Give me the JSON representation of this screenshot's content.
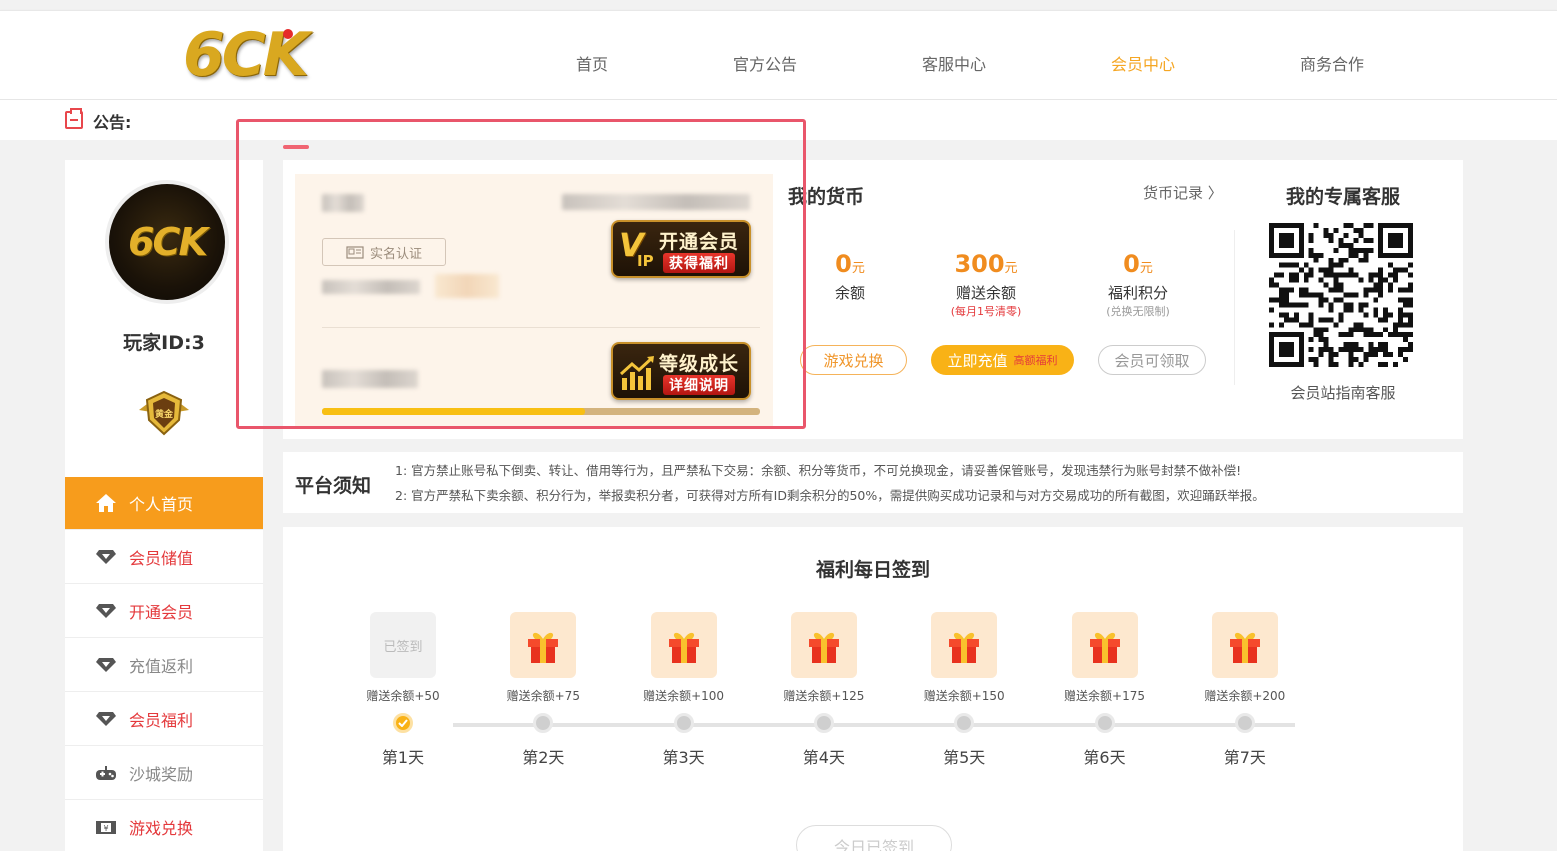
{
  "header": {
    "logo_text": "6CK",
    "nav": [
      "首页",
      "官方公告",
      "客服中心",
      "会员中心",
      "商务合作"
    ],
    "active_nav": "会员中心"
  },
  "notice": {
    "label": "公告:"
  },
  "sidebar": {
    "avatar_text": "6CK",
    "player_id": "玩家ID:3",
    "rank_badge_text": "黄金",
    "menu": [
      {
        "label": "个人首页",
        "icon": "home-icon",
        "style": "active"
      },
      {
        "label": "会员储值",
        "icon": "diamond-icon",
        "style": "red"
      },
      {
        "label": "开通会员",
        "icon": "diamond-icon",
        "style": "red"
      },
      {
        "label": "充值返利",
        "icon": "diamond-icon",
        "style": "gray"
      },
      {
        "label": "会员福利",
        "icon": "diamond-icon",
        "style": "red"
      },
      {
        "label": "沙城奖励",
        "icon": "gamepad-icon",
        "style": "gray"
      },
      {
        "label": "游戏兑换",
        "icon": "ticket-icon",
        "style": "red"
      }
    ]
  },
  "user_card": {
    "realname_label": "实名认证",
    "vip_badge": {
      "mark": "V",
      "sub": "IP",
      "title": "开通会员",
      "subtitle": "获得福利"
    },
    "level_badge": {
      "title": "等级成长",
      "subtitle": "详细说明"
    },
    "level_progress": 0.6
  },
  "currency": {
    "title": "我的货币",
    "record_link": "货币记录",
    "items": [
      {
        "amount": "0",
        "unit": "元",
        "label": "余额",
        "sub": ""
      },
      {
        "amount": "300",
        "unit": "元",
        "label": "赠送余额",
        "sub": "(每月1号清零)"
      },
      {
        "amount": "0",
        "unit": "元",
        "label": "福利积分",
        "sub": "(兑换无限制)"
      }
    ],
    "buttons": {
      "exchange": "游戏兑换",
      "recharge": "立即充值",
      "recharge_tag": "高额福利",
      "claim": "会员可领取"
    }
  },
  "service": {
    "title": "我的专属客服",
    "label": "会员站指南客服"
  },
  "platform": {
    "title": "平台须知",
    "lines": [
      "1:  官方禁止账号私下倒卖、转让、借用等行为，且严禁私下交易：余额、积分等货币，不可兑换现金，请妥善保管账号，发现违禁行为账号封禁不做补偿!",
      "2:  官方严禁私下卖余额、积分行为，举报卖积分者，可获得对方所有ID剩余积分的50%，需提供购买成功记录和与对方交易成功的所有截图，欢迎踊跃举报。"
    ]
  },
  "checkin": {
    "title": "福利每日签到",
    "signed_label": "已签到",
    "days": [
      {
        "reward": "赠送余额+50",
        "label": "第1天",
        "done": true
      },
      {
        "reward": "赠送余额+75",
        "label": "第2天",
        "done": false
      },
      {
        "reward": "赠送余额+100",
        "label": "第3天",
        "done": false
      },
      {
        "reward": "赠送余额+125",
        "label": "第4天",
        "done": false
      },
      {
        "reward": "赠送余额+150",
        "label": "第5天",
        "done": false
      },
      {
        "reward": "赠送余额+175",
        "label": "第6天",
        "done": false
      },
      {
        "reward": "赠送余额+200",
        "label": "第7天",
        "done": false
      }
    ],
    "today_button": "今日已签到"
  },
  "colors": {
    "accent": "#f79c1c",
    "highlight_box": "#e9566b",
    "red": "#e4393c"
  }
}
